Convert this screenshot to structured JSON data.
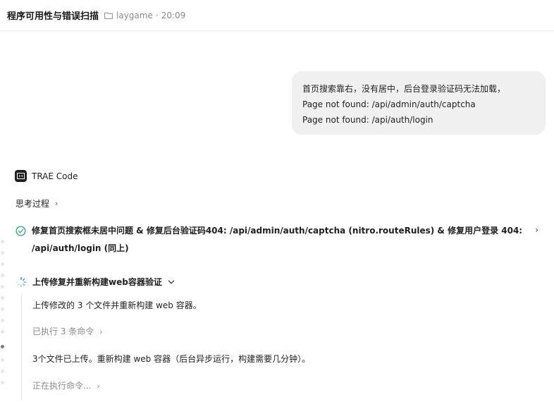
{
  "header": {
    "title": "程序可用性与错误扫描",
    "project": "laygame",
    "separator": "·",
    "time": "20:09"
  },
  "user_message": {
    "lines": [
      "首页搜索靠右，没有居中，后台登录验证码无法加载，",
      "Page not found: /api/admin/auth/captcha",
      "Page not found: /api/auth/login"
    ]
  },
  "assistant": {
    "name": "TRAE Code",
    "thinking_label": "思考过程",
    "task_done": {
      "text": "修复首页搜索框未居中问题 & 修复后台验证码404: /api/admin/auth/captcha (nitro.routeRules) & 修复用户登录 404: /api/auth/login (同上)",
      "status": "completed"
    },
    "task_running": {
      "title": "上传修复并重新构建web容器验证",
      "status": "running",
      "steps": [
        "上传修改的 3 个文件并重新构建 web 容器。",
        "已执行 3 条命令",
        "3个文件已上传。重新构建 web 容器（后台异步运行，构建需要几分钟）。",
        "正在执行命令..."
      ]
    }
  },
  "colors": {
    "success": "#2aa876",
    "bubble_bg": "#f0f0f0",
    "muted_text": "#8a8a8a"
  },
  "icons": {
    "folder": "folder-icon",
    "agent": "agent-logo-icon",
    "check": "check-circle-icon",
    "spinner": "spinner-icon",
    "chevron_right": "chevron-right-icon",
    "chevron_down": "chevron-down-icon"
  }
}
